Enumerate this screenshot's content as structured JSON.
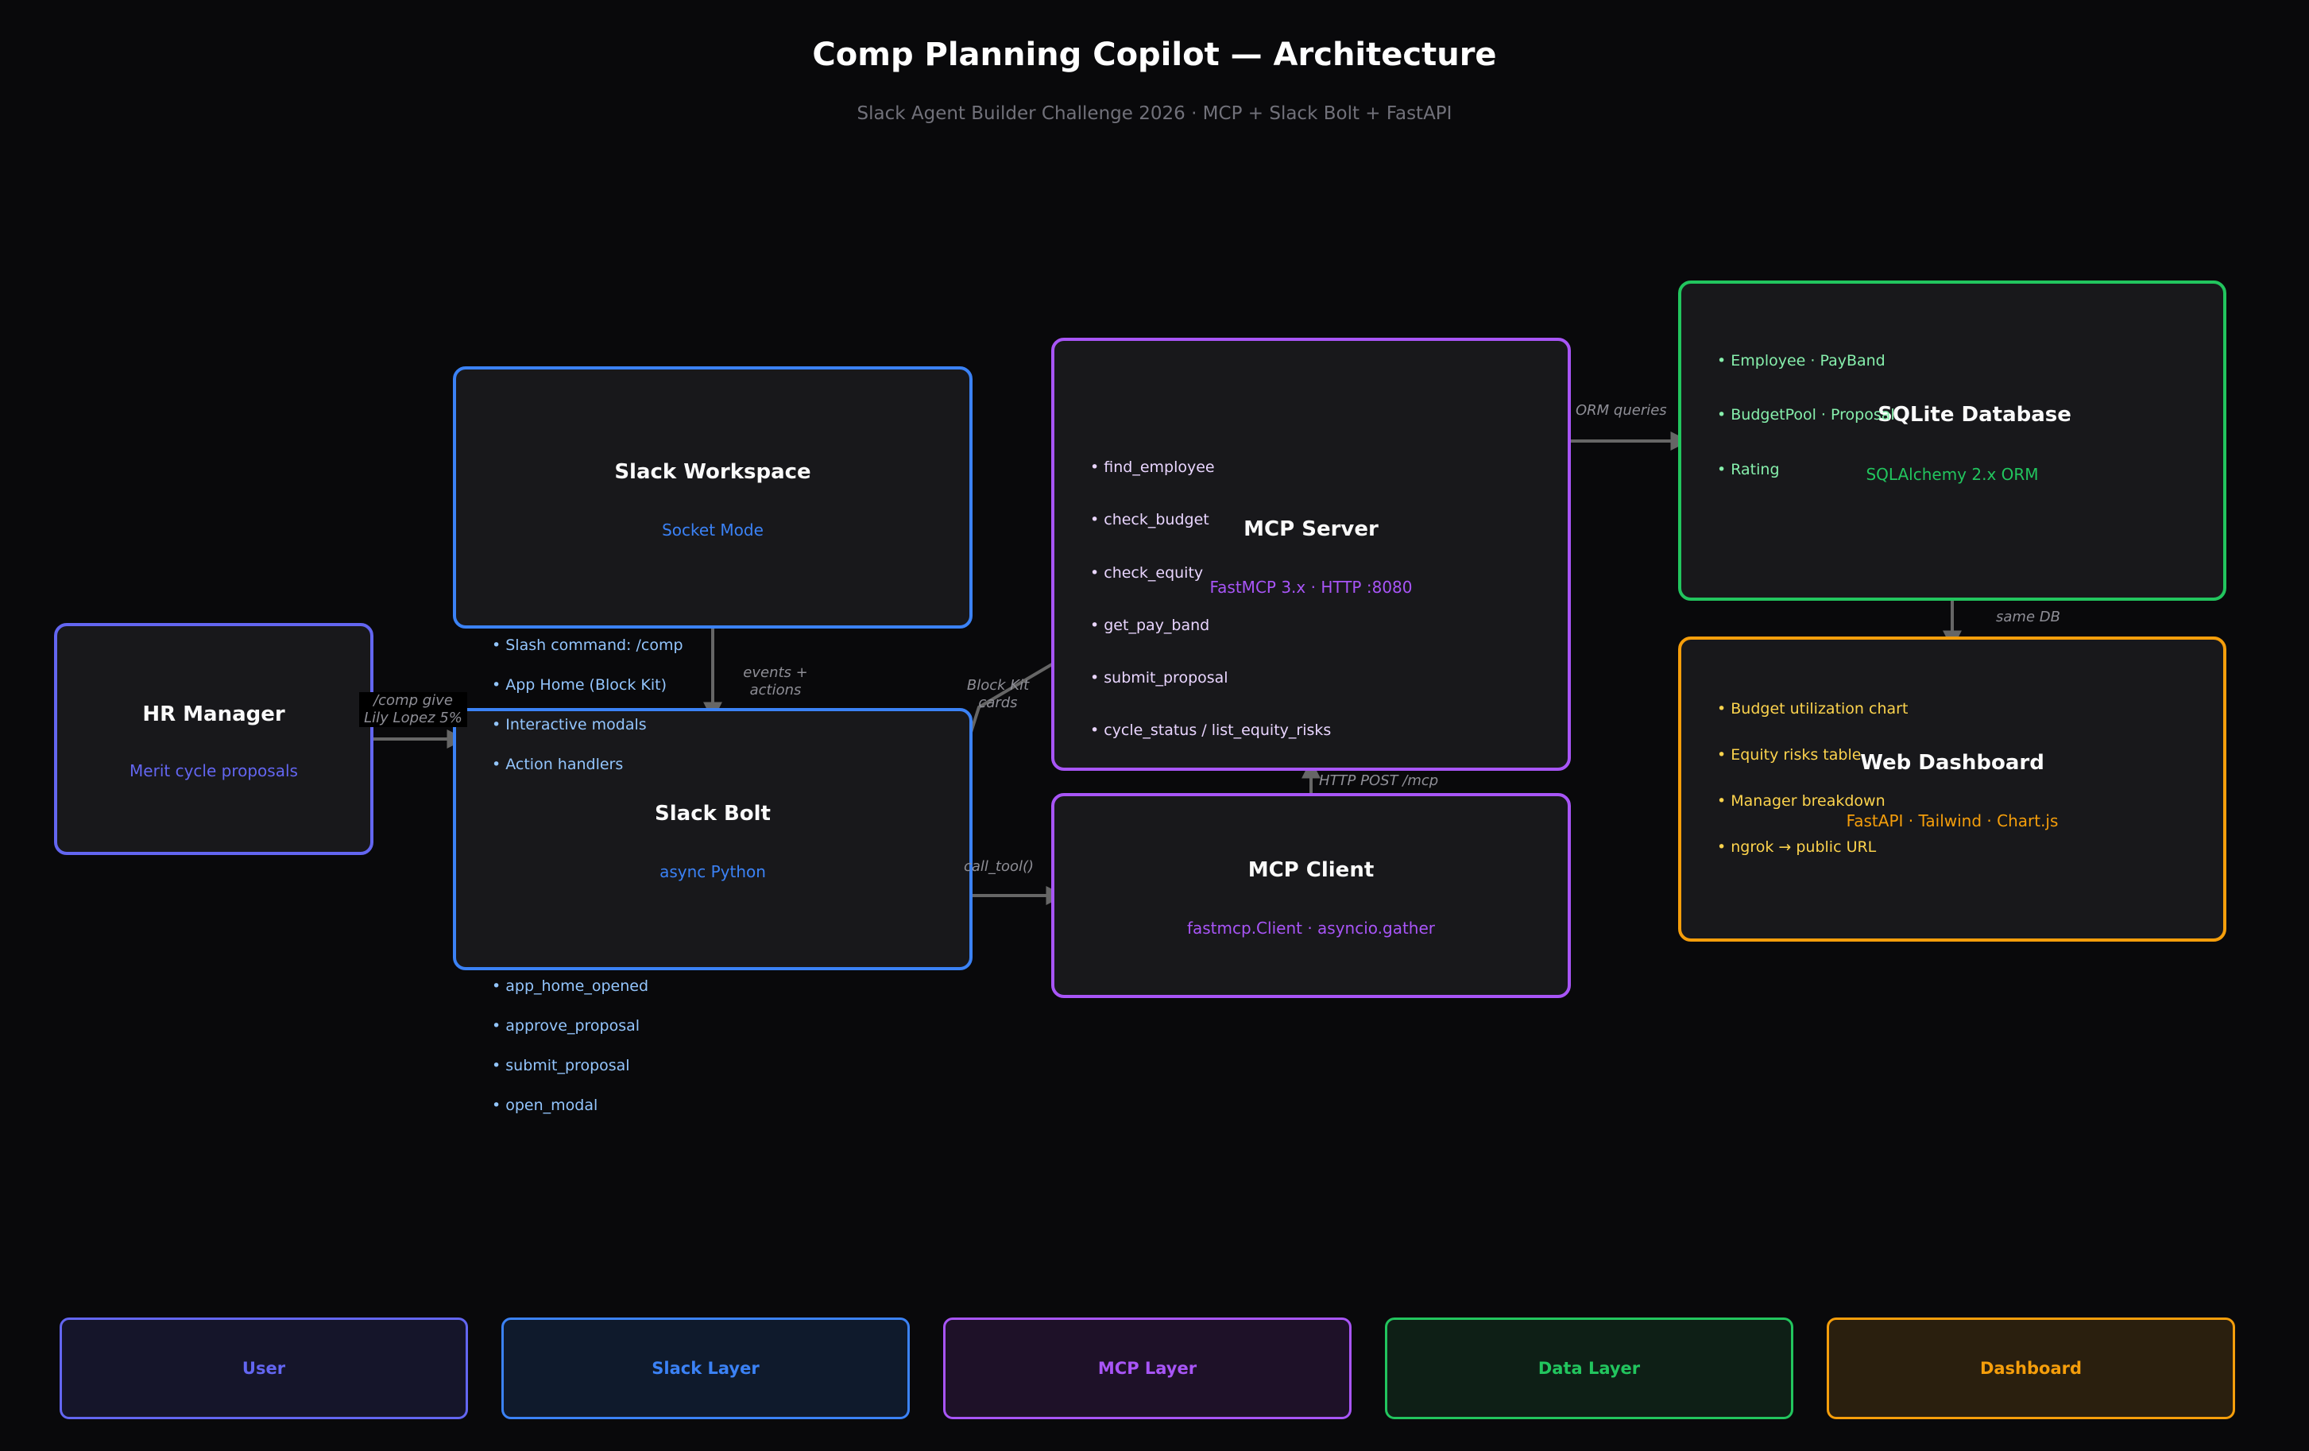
{
  "title": "Comp Planning Copilot — Architecture",
  "subtitle": "Slack Agent Builder Challenge 2026  ·  MCP + Slack Bolt + FastAPI",
  "colors": {
    "user": "#6366f1",
    "slack": "#3b82f6",
    "mcp": "#a855f7",
    "data": "#22c55e",
    "dashboard": "#f59e0b",
    "arrow": "#666666"
  },
  "nodes": {
    "hr_manager": {
      "title": "HR Manager",
      "subtitle": "Merit cycle proposals"
    },
    "slack_workspace": {
      "title": "Slack Workspace",
      "subtitle": "Socket Mode",
      "bullets": [
        "• Slash command: /comp",
        "• App Home (Block Kit)",
        "• Interactive modals",
        "• Action handlers"
      ]
    },
    "slack_bolt": {
      "title": "Slack Bolt",
      "subtitle": "async Python",
      "bullets": [
        "• app_home_opened",
        "• approve_proposal",
        "• submit_proposal",
        "• open_modal"
      ]
    },
    "mcp_server": {
      "title": "MCP Server",
      "subtitle": "FastMCP 3.x · HTTP :8080",
      "bullets": [
        "• find_employee",
        "• check_budget",
        "• check_equity",
        "• get_pay_band",
        "• submit_proposal",
        "• cycle_status  /  list_equity_risks"
      ]
    },
    "mcp_client": {
      "title": "MCP Client",
      "subtitle": "fastmcp.Client · asyncio.gather"
    },
    "sqlite": {
      "title": "SQLite Database",
      "subtitle": "SQLAlchemy 2.x ORM",
      "bullets": [
        "• Employee  ·  PayBand",
        "• BudgetPool  ·  Proposal",
        "• Rating"
      ]
    },
    "web_dashboard": {
      "title": "Web Dashboard",
      "subtitle": "FastAPI · Tailwind · Chart.js",
      "bullets": [
        "• Budget utilization chart",
        "• Equity risks table",
        "• Manager breakdown",
        "• ngrok → public URL"
      ]
    }
  },
  "edges": {
    "comp_give": [
      "/comp give",
      "Lily Lopez 5%"
    ],
    "events_actions": [
      "events +",
      "actions"
    ],
    "block_kit_cards": [
      "Block Kit",
      "cards"
    ],
    "call_tool": "call_tool()",
    "http_post": "HTTP POST /mcp",
    "orm_queries": "ORM queries",
    "same_db": "same DB"
  },
  "legend": {
    "user": "User",
    "slack": "Slack Layer",
    "mcp": "MCP Layer",
    "data": "Data Layer",
    "dashboard": "Dashboard"
  }
}
